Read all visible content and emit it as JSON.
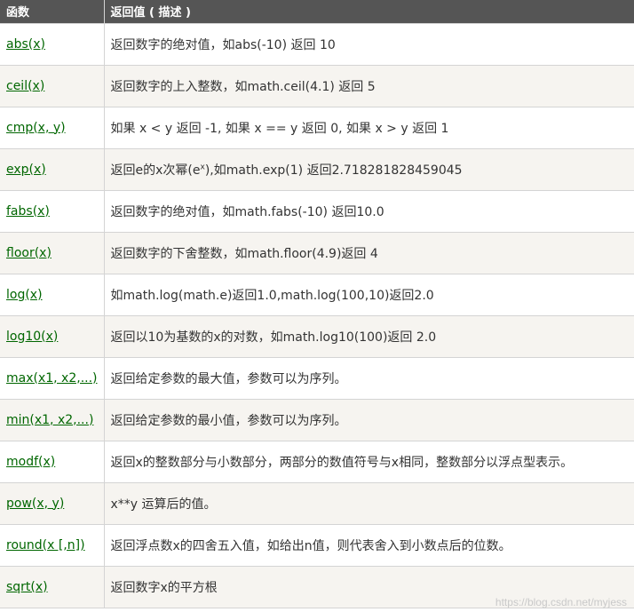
{
  "header": {
    "col_function": "函数",
    "col_description": "返回值 ( 描述 )"
  },
  "rows": [
    {
      "fn": "abs(x)",
      "desc": "返回数字的绝对值，如abs(-10) 返回 10"
    },
    {
      "fn": "ceil(x)",
      "desc": "返回数字的上入整数，如math.ceil(4.1) 返回 5"
    },
    {
      "fn": "cmp(x, y)",
      "desc": "如果 x < y 返回 -1, 如果 x == y 返回 0, 如果 x > y 返回 1"
    },
    {
      "fn": "exp(x)",
      "desc_pre": "返回e的x次幂(e",
      "desc_sup": "x",
      "desc_post": "),如math.exp(1) 返回2.718281828459045"
    },
    {
      "fn": "fabs(x)",
      "desc": "返回数字的绝对值，如math.fabs(-10) 返回10.0"
    },
    {
      "fn": "floor(x)",
      "desc": "返回数字的下舍整数，如math.floor(4.9)返回 4"
    },
    {
      "fn": "log(x)",
      "desc": "如math.log(math.e)返回1.0,math.log(100,10)返回2.0"
    },
    {
      "fn": "log10(x)",
      "desc": "返回以10为基数的x的对数，如math.log10(100)返回 2.0"
    },
    {
      "fn": "max(x1, x2,...)",
      "desc": "返回给定参数的最大值，参数可以为序列。"
    },
    {
      "fn": "min(x1, x2,...)",
      "desc": "返回给定参数的最小值，参数可以为序列。"
    },
    {
      "fn": "modf(x)",
      "desc": "返回x的整数部分与小数部分，两部分的数值符号与x相同，整数部分以浮点型表示。"
    },
    {
      "fn": "pow(x, y)",
      "desc": "x**y 运算后的值。"
    },
    {
      "fn": "round(x [,n])",
      "desc": "返回浮点数x的四舍五入值，如给出n值，则代表舍入到小数点后的位数。"
    },
    {
      "fn": "sqrt(x)",
      "desc": "返回数字x的平方根"
    }
  ],
  "watermark": "https://blog.csdn.net/myjess",
  "colors": {
    "header_bg": "#555555",
    "link": "#006600",
    "row_alt": "#f6f4f0",
    "border": "#d4d4d4"
  }
}
